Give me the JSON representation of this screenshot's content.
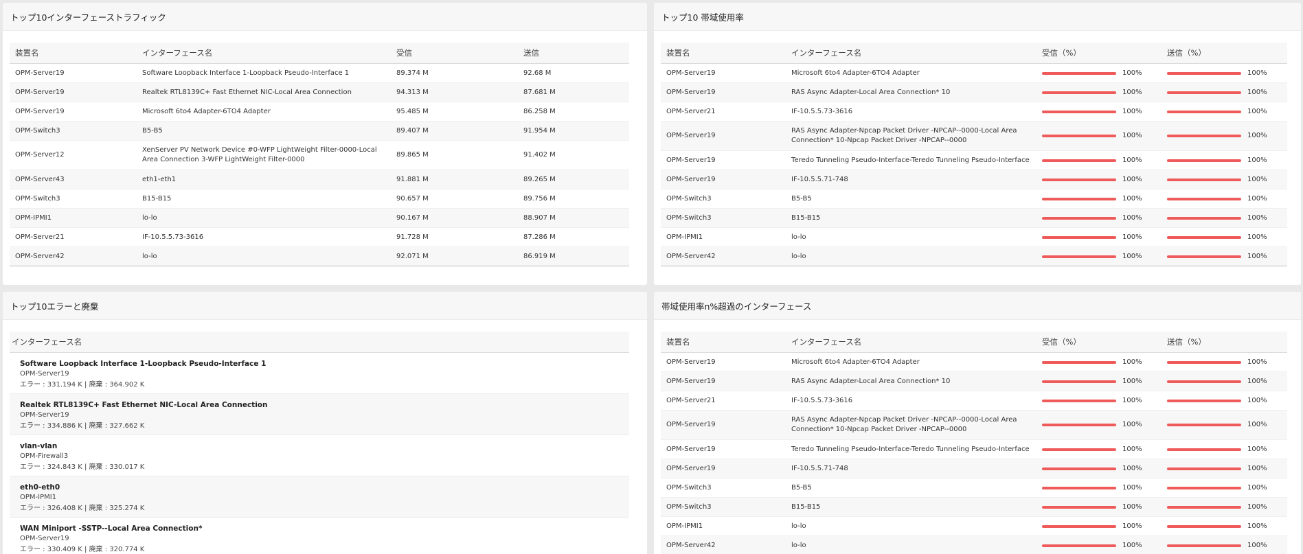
{
  "traffic": {
    "title": "トップ10インターフェーストラフィック",
    "headers": {
      "device": "装置名",
      "iface": "インターフェース名",
      "rx": "受信",
      "tx": "送信"
    },
    "rows": [
      {
        "device": "OPM-Server19",
        "iface": "Software Loopback Interface 1-Loopback Pseudo-Interface 1",
        "rx": "89.374 M",
        "tx": "92.68 M"
      },
      {
        "device": "OPM-Server19",
        "iface": "Realtek RTL8139C+ Fast Ethernet NIC-Local Area Connection",
        "rx": "94.313 M",
        "tx": "87.681 M"
      },
      {
        "device": "OPM-Server19",
        "iface": "Microsoft 6to4 Adapter-6TO4 Adapter",
        "rx": "95.485 M",
        "tx": "86.258 M"
      },
      {
        "device": "OPM-Switch3",
        "iface": "B5-B5",
        "rx": "89.407 M",
        "tx": "91.954 M"
      },
      {
        "device": "OPM-Server12",
        "iface": "XenServer PV Network Device #0-WFP LightWeight Filter-0000-Local Area Connection 3-WFP LightWeight Filter-0000",
        "rx": "89.865 M",
        "tx": "91.402 M"
      },
      {
        "device": "OPM-Server43",
        "iface": "eth1-eth1",
        "rx": "91.881 M",
        "tx": "89.265 M"
      },
      {
        "device": "OPM-Switch3",
        "iface": "B15-B15",
        "rx": "90.657 M",
        "tx": "89.756 M"
      },
      {
        "device": "OPM-IPMI1",
        "iface": "lo-lo",
        "rx": "90.167 M",
        "tx": "88.907 M"
      },
      {
        "device": "OPM-Server21",
        "iface": "IF-10.5.5.73-3616",
        "rx": "91.728 M",
        "tx": "87.286 M"
      },
      {
        "device": "OPM-Server42",
        "iface": "lo-lo",
        "rx": "92.071 M",
        "tx": "86.919 M"
      }
    ]
  },
  "bandwidth": {
    "title": "トップ10 帯域使用率",
    "headers": {
      "device": "装置名",
      "iface": "インターフェース名",
      "rx": "受信（%）",
      "tx": "送信（%）"
    },
    "rows": [
      {
        "device": "OPM-Server19",
        "iface": "Microsoft 6to4 Adapter-6TO4 Adapter",
        "rx": "100%",
        "tx": "100%",
        "rx_pct": 100,
        "tx_pct": 100
      },
      {
        "device": "OPM-Server19",
        "iface": "RAS Async Adapter-Local Area Connection* 10",
        "rx": "100%",
        "tx": "100%",
        "rx_pct": 100,
        "tx_pct": 100
      },
      {
        "device": "OPM-Server21",
        "iface": "IF-10.5.5.73-3616",
        "rx": "100%",
        "tx": "100%",
        "rx_pct": 100,
        "tx_pct": 100
      },
      {
        "device": "OPM-Server19",
        "iface": "RAS Async Adapter-Npcap Packet Driver -NPCAP--0000-Local Area Connection* 10-Npcap Packet Driver -NPCAP--0000",
        "rx": "100%",
        "tx": "100%",
        "rx_pct": 100,
        "tx_pct": 100
      },
      {
        "device": "OPM-Server19",
        "iface": "Teredo Tunneling Pseudo-Interface-Teredo Tunneling Pseudo-Interface",
        "rx": "100%",
        "tx": "100%",
        "rx_pct": 100,
        "tx_pct": 100
      },
      {
        "device": "OPM-Server19",
        "iface": "IF-10.5.5.71-748",
        "rx": "100%",
        "tx": "100%",
        "rx_pct": 100,
        "tx_pct": 100
      },
      {
        "device": "OPM-Switch3",
        "iface": "B5-B5",
        "rx": "100%",
        "tx": "100%",
        "rx_pct": 100,
        "tx_pct": 100
      },
      {
        "device": "OPM-Switch3",
        "iface": "B15-B15",
        "rx": "100%",
        "tx": "100%",
        "rx_pct": 100,
        "tx_pct": 100
      },
      {
        "device": "OPM-IPMI1",
        "iface": "lo-lo",
        "rx": "100%",
        "tx": "100%",
        "rx_pct": 100,
        "tx_pct": 100
      },
      {
        "device": "OPM-Server42",
        "iface": "lo-lo",
        "rx": "100%",
        "tx": "100%",
        "rx_pct": 100,
        "tx_pct": 100
      }
    ]
  },
  "errors": {
    "title": "トップ10エラーと廃棄",
    "header": "インターフェース名",
    "items": [
      {
        "name": "Software Loopback Interface 1-Loopback Pseudo-Interface 1",
        "device": "OPM-Server19",
        "stat": "エラー : 331.194 K | 廃棄 : 364.902 K"
      },
      {
        "name": "Realtek RTL8139C+ Fast Ethernet NIC-Local Area Connection",
        "device": "OPM-Server19",
        "stat": "エラー : 334.886 K | 廃棄 : 327.662 K"
      },
      {
        "name": "vlan-vlan",
        "device": "OPM-Firewall3",
        "stat": "エラー : 324.843 K | 廃棄 : 330.017 K"
      },
      {
        "name": "eth0-eth0",
        "device": "OPM-IPMI1",
        "stat": "エラー : 326.408 K | 廃棄 : 325.274 K"
      },
      {
        "name": "WAN Miniport -SSTP--Local Area Connection*",
        "device": "OPM-Server19",
        "stat": "エラー : 330.409 K | 廃棄 : 320.774 K"
      }
    ]
  },
  "over_threshold": {
    "title": "帯域使用率n%超過のインターフェース",
    "headers": {
      "device": "装置名",
      "iface": "インターフェース名",
      "rx": "受信（%）",
      "tx": "送信（%）"
    },
    "rows": [
      {
        "device": "OPM-Server19",
        "iface": "Microsoft 6to4 Adapter-6TO4 Adapter",
        "rx": "100%",
        "tx": "100%",
        "rx_pct": 100,
        "tx_pct": 100
      },
      {
        "device": "OPM-Server19",
        "iface": "RAS Async Adapter-Local Area Connection* 10",
        "rx": "100%",
        "tx": "100%",
        "rx_pct": 100,
        "tx_pct": 100
      },
      {
        "device": "OPM-Server21",
        "iface": "IF-10.5.5.73-3616",
        "rx": "100%",
        "tx": "100%",
        "rx_pct": 100,
        "tx_pct": 100
      },
      {
        "device": "OPM-Server19",
        "iface": "RAS Async Adapter-Npcap Packet Driver -NPCAP--0000-Local Area Connection* 10-Npcap Packet Driver -NPCAP--0000",
        "rx": "100%",
        "tx": "100%",
        "rx_pct": 100,
        "tx_pct": 100
      },
      {
        "device": "OPM-Server19",
        "iface": "Teredo Tunneling Pseudo-Interface-Teredo Tunneling Pseudo-Interface",
        "rx": "100%",
        "tx": "100%",
        "rx_pct": 100,
        "tx_pct": 100
      },
      {
        "device": "OPM-Server19",
        "iface": "IF-10.5.5.71-748",
        "rx": "100%",
        "tx": "100%",
        "rx_pct": 100,
        "tx_pct": 100
      },
      {
        "device": "OPM-Switch3",
        "iface": "B5-B5",
        "rx": "100%",
        "tx": "100%",
        "rx_pct": 100,
        "tx_pct": 100
      },
      {
        "device": "OPM-Switch3",
        "iface": "B15-B15",
        "rx": "100%",
        "tx": "100%",
        "rx_pct": 100,
        "tx_pct": 100
      },
      {
        "device": "OPM-IPMI1",
        "iface": "lo-lo",
        "rx": "100%",
        "tx": "100%",
        "rx_pct": 100,
        "tx_pct": 100
      },
      {
        "device": "OPM-Server42",
        "iface": "lo-lo",
        "rx": "100%",
        "tx": "100%",
        "rx_pct": 100,
        "tx_pct": 100
      }
    ]
  },
  "colors": {
    "bar": "#ef5a5a",
    "panel_header": "#f7f7f7",
    "page_bg": "#e9e9e9"
  }
}
